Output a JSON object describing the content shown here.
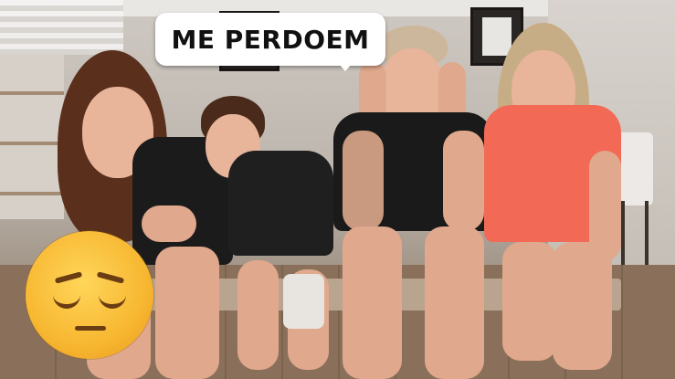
{
  "caption": {
    "text": "ME PERDOEM"
  },
  "emoji": {
    "icon": "pensive-face-emoji",
    "color": "#f7b731"
  },
  "scene": {
    "people": [
      {
        "name": "woman-left",
        "shirt_color": "#1b1b1b"
      },
      {
        "name": "boy",
        "shirt_color": "#1f1f1f"
      },
      {
        "name": "man-center",
        "shirt_color": "#1a1a1a"
      },
      {
        "name": "woman-right",
        "shirt_color": "#f26a55"
      }
    ]
  }
}
